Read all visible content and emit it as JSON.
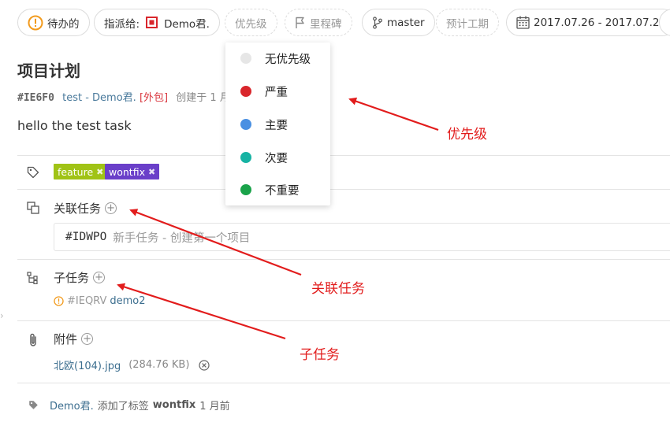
{
  "toolbar": {
    "status_label": "待办的",
    "assignee_prefix": "指派给:",
    "assignee_name": "Demo君.",
    "priority_label": "优先级",
    "milestone_label": "里程碑",
    "branch_label": "master",
    "estimate_label": "预计工期",
    "date_range": "2017.07.26 - 2017.07.27"
  },
  "priority_menu": {
    "items": [
      {
        "label": "无优先级",
        "color": "#e6e6e6"
      },
      {
        "label": "严重",
        "color": "#d9262c"
      },
      {
        "label": "主要",
        "color": "#4a90e2"
      },
      {
        "label": "次要",
        "color": "#17b3a3"
      },
      {
        "label": "不重要",
        "color": "#1aa34a"
      }
    ]
  },
  "task": {
    "title": "项目计划",
    "id": "#IE6F0",
    "project": "test - Demo君.",
    "visibility": "[外包]",
    "created": "创建于 1 月",
    "description": "hello the test task"
  },
  "labels": [
    {
      "text": "feature",
      "color": "#a0c316"
    },
    {
      "text": "wontfix",
      "color": "#6a3fc9"
    }
  ],
  "linked": {
    "title": "关联任务",
    "item_id": "#IDWPO",
    "item_text": "新手任务 - 创建第一个项目"
  },
  "subtasks": {
    "title": "子任务",
    "item_id": "#IEQRV",
    "item_name": "demo2"
  },
  "attachments": {
    "title": "附件",
    "file_name": "北欧(104).jpg",
    "file_size": "(284.76 KB)"
  },
  "activity": {
    "user": "Demo君.",
    "action": "添加了标签",
    "label": "wontfix",
    "time": "1 月前"
  },
  "annotations": {
    "priority": "优先级",
    "linked": "关联任务",
    "subtask": "子任务"
  },
  "colors": {
    "annotation_red": "#e21c1c",
    "status_orange": "#f29a1c",
    "assignee_red": "#d9262c"
  }
}
